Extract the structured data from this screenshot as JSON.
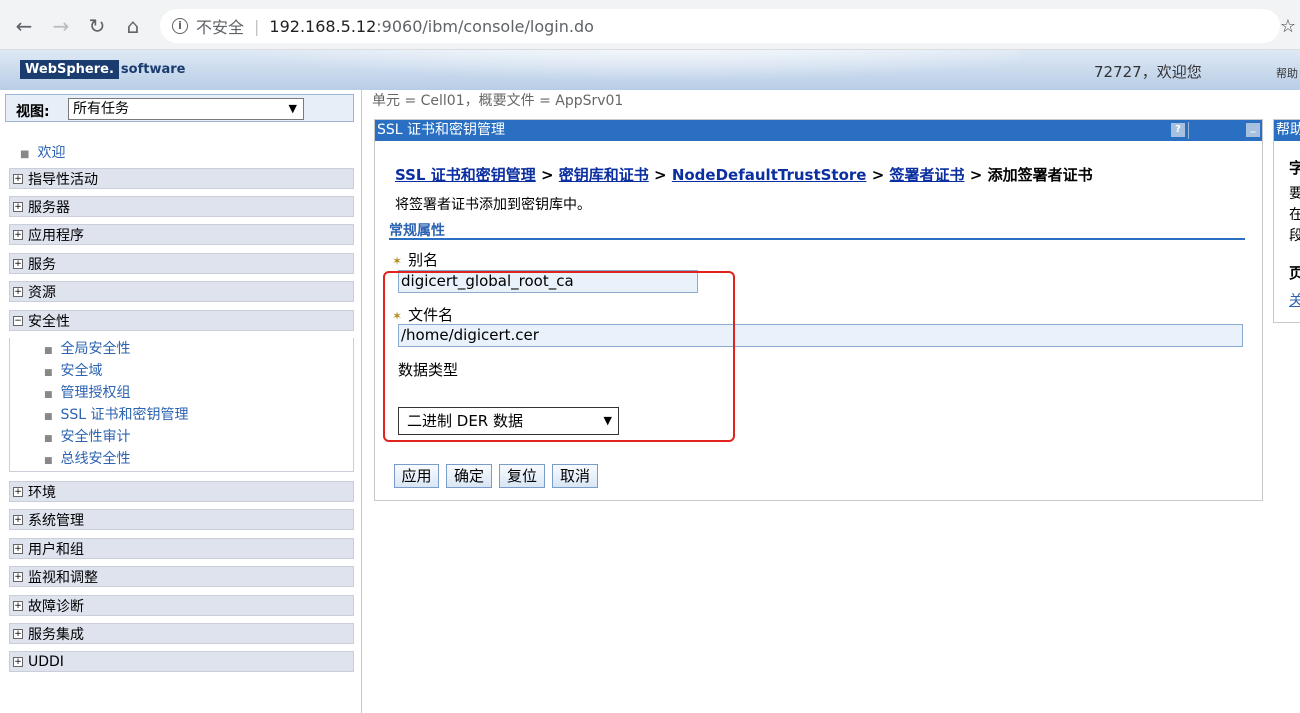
{
  "browser": {
    "insecure_label": "不安全",
    "url_host": "192.168.5.12",
    "url_rest": ":9060/ibm/console/login.do"
  },
  "header": {
    "logo_brand": "WebSphere.",
    "logo_suffix": "software",
    "welcome": "72727，欢迎您",
    "help": "帮助"
  },
  "sidebar": {
    "view_label": "视图:",
    "view_value": "所有任务",
    "welcome_link": "欢迎",
    "items": [
      {
        "label": "指导性活动"
      },
      {
        "label": "服务器"
      },
      {
        "label": "应用程序"
      },
      {
        "label": "服务"
      },
      {
        "label": "资源"
      },
      {
        "label": "安全性"
      },
      {
        "label": "环境"
      },
      {
        "label": "系统管理"
      },
      {
        "label": "用户和组"
      },
      {
        "label": "监视和调整"
      },
      {
        "label": "故障诊断"
      },
      {
        "label": "服务集成"
      },
      {
        "label": "UDDI"
      }
    ],
    "security_sub": [
      {
        "label": "全局安全性"
      },
      {
        "label": "安全域"
      },
      {
        "label": "管理授权组"
      },
      {
        "label": "SSL 证书和密钥管理"
      },
      {
        "label": "安全性审计"
      },
      {
        "label": "总线安全性"
      }
    ]
  },
  "main": {
    "scope": "单元 = Cell01，概要文件 = AppSrv01",
    "panel_title": "SSL 证书和密钥管理",
    "breadcrumbs": {
      "c1": "SSL 证书和密钥管理",
      "c2": "密钥库和证书",
      "c3": "NodeDefaultTrustStore",
      "c4": "签署者证书",
      "current": "添加签署者证书",
      "sep": ">"
    },
    "description": "将签署者证书添加到密钥库中。",
    "section_title": "常规属性",
    "alias_label": "别名",
    "alias_value": "digicert_global_root_ca",
    "file_label": "文件名",
    "file_value": "/home/digicert.cer",
    "type_label": "数据类型",
    "type_value": "二进制 DER 数据",
    "buttons": {
      "apply": "应用",
      "ok": "确定",
      "reset": "复位",
      "cancel": "取消"
    }
  },
  "help_panel": {
    "title": "帮助",
    "lines": [
      "字",
      "要",
      "在",
      "段",
      "页",
      "关"
    ]
  }
}
